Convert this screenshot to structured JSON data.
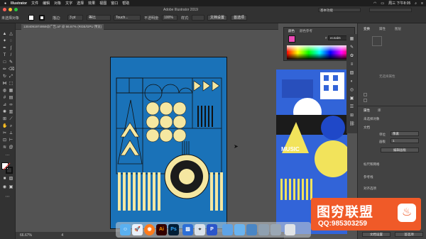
{
  "menubar": {
    "app_name": "Illustrator",
    "menus": [
      "文件",
      "编辑",
      "对象",
      "文字",
      "选择",
      "效果",
      "视图",
      "窗口",
      "帮助"
    ],
    "clock": "周三 下午8:05"
  },
  "window_title": "Adobe Illustrator 2019",
  "control_bar": {
    "section_label": "描边:",
    "stroke_weight": "3 pt",
    "stroke_profile": "等比",
    "brush": "Touch...",
    "opacity_label": "不透明度:",
    "opacity": "100%",
    "style_label": "样式:",
    "doc_setup": "文档设置",
    "prefs": "首选项",
    "left_label": "未选择对象",
    "top_right_label": "基本功能"
  },
  "document": {
    "tab_title": "1304091974959@广告.ai* @ 66.67% (RGB/GPU 预览)",
    "zoom": "66.67%",
    "page": "4"
  },
  "color_panel": {
    "tabs": [
      "颜色",
      "颜色参考"
    ],
    "hex": "ec4ab5"
  },
  "right_panel": {
    "tabs": [
      "变换",
      "属性",
      "图层"
    ],
    "no_selection": "无选择属性",
    "section2_tabs": [
      "属性",
      "库"
    ],
    "no_selection2": "未选择对象",
    "doc_label": "文档",
    "units_label": "单位",
    "units_value": "像素",
    "artboard_label": "画板",
    "artboard_value": "1",
    "edit_artboard": "编辑画板",
    "rulers_label": "标尺和网格",
    "guides_label": "参考线",
    "snap_label": "对齐选项",
    "prefs_label": "首选项",
    "keyboard_label": "键盘增量:",
    "keyboard_value": "0.3528 m",
    "doc_setup_button": "文档设置",
    "prefs_button": "首选项"
  },
  "artwork": {
    "music_label": "MUSIC"
  },
  "dock": {
    "ai_label": "Ai",
    "ps_label": "Ps",
    "p_label": "P"
  },
  "watermark": {
    "title": "图穷联盟",
    "qq": "QQ:985303259"
  },
  "colors": {
    "artboard_blue": "#1a72b8",
    "cream": "#f5e7a1",
    "dark": "#1b1b1b",
    "artboard2_blue": "#3264d8",
    "watermark_orange": "#f05a28"
  }
}
